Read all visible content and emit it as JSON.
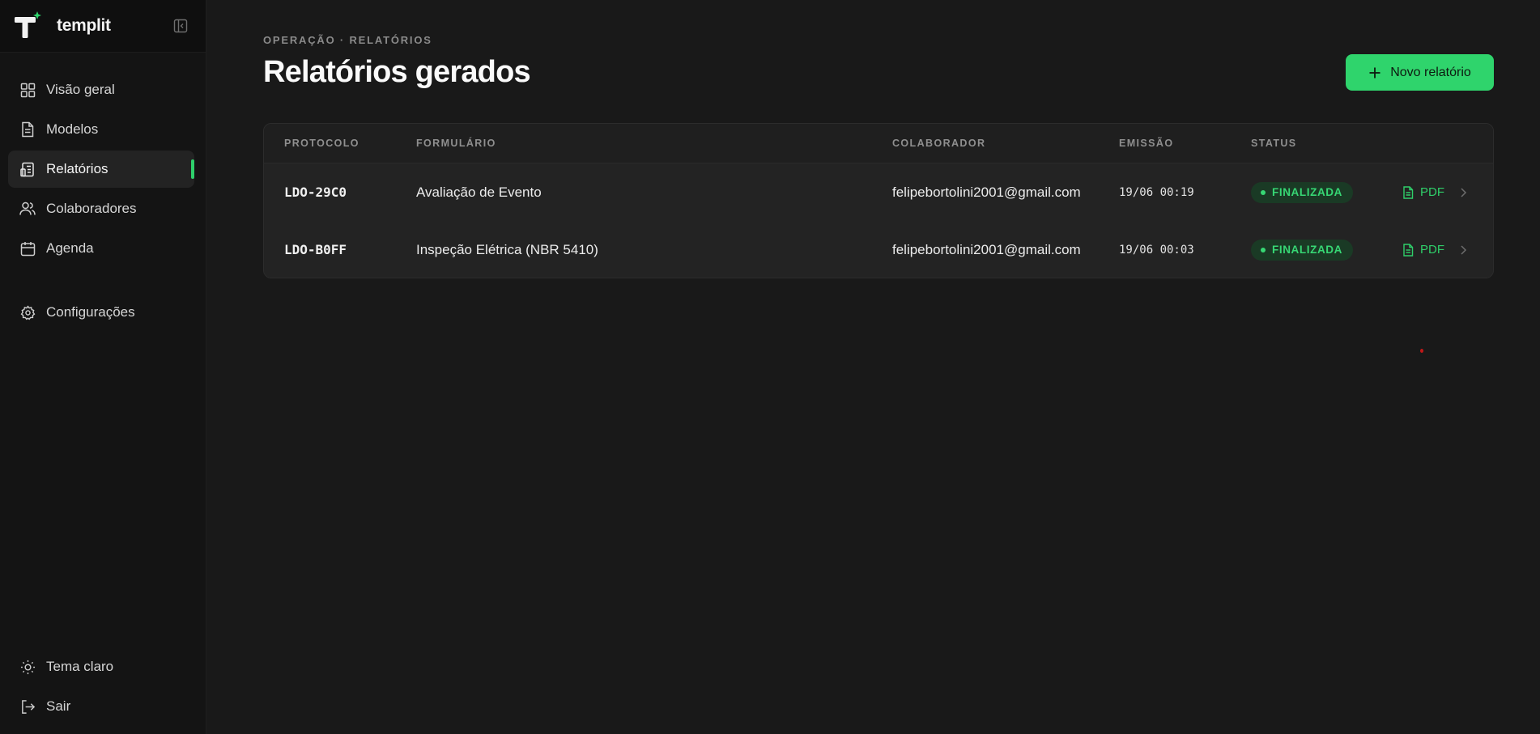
{
  "app": {
    "brand_name": "templit",
    "accent_color": "#2fd46c"
  },
  "sidebar": {
    "items": [
      {
        "label": "Visão geral",
        "icon": "grid-icon"
      },
      {
        "label": "Modelos",
        "icon": "document-icon"
      },
      {
        "label": "Relatórios",
        "icon": "report-icon",
        "active": true
      },
      {
        "label": "Colaboradores",
        "icon": "users-icon"
      },
      {
        "label": "Agenda",
        "icon": "calendar-icon"
      }
    ],
    "settings": {
      "label": "Configurações",
      "icon": "gear-icon"
    },
    "bottom": [
      {
        "label": "Tema claro",
        "icon": "sun-icon"
      },
      {
        "label": "Sair",
        "icon": "logout-icon"
      }
    ]
  },
  "header": {
    "breadcrumb": "OPERAÇÃO · RELATÓRIOS",
    "title": "Relatórios gerados",
    "new_button_label": "Novo relatório"
  },
  "table": {
    "columns": [
      "PROTOCOLO",
      "FORMULÁRIO",
      "COLABORADOR",
      "EMISSÃO",
      "STATUS"
    ],
    "rows": [
      {
        "protocol": "LDO-29C0",
        "form": "Avaliação de Evento",
        "collaborator": "felipebortolini2001@gmail.com",
        "issued": "19/06 00:19",
        "status": "FINALIZADA",
        "pdf_label": "PDF"
      },
      {
        "protocol": "LDO-B0FF",
        "form": "Inspeção Elétrica (NBR 5410)",
        "collaborator": "felipebortolini2001@gmail.com",
        "issued": "19/06 00:03",
        "status": "FINALIZADA",
        "pdf_label": "PDF"
      }
    ]
  }
}
